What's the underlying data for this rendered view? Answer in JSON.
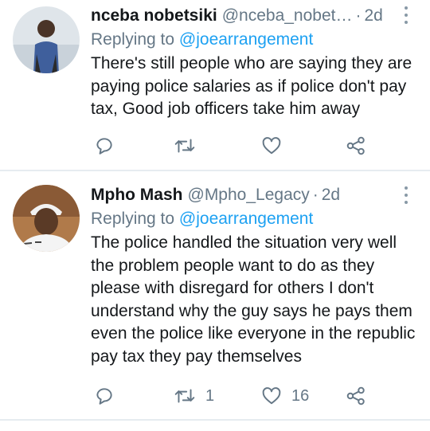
{
  "tweets": [
    {
      "name": "nceba nobetsiki",
      "handle": "@nceba_nobet…",
      "separator": "·",
      "time": "2d",
      "replying_prefix": "Replying to ",
      "replying_handle": "@joearrangement",
      "text": "There's still people who are saying they are paying police salaries as if police don't pay tax, Good job officers take him away",
      "reply_count": "",
      "retweet_count": "",
      "like_count": ""
    },
    {
      "name": "Mpho Mash",
      "handle": "@Mpho_Legacy",
      "separator": "·",
      "time": "2d",
      "replying_prefix": "Replying to ",
      "replying_handle": "@joearrangement",
      "text": "The police handled the situation very well the problem people want to do as they please with disregard for others I don't understand why the guy says he pays them even the police like everyone in the republic pay tax they pay themselves",
      "reply_count": "",
      "retweet_count": "1",
      "like_count": "16"
    }
  ],
  "icons": {
    "reply": "reply-icon",
    "retweet": "retweet-icon",
    "like": "heart-icon",
    "share": "share-icon",
    "more": "more-vertical-icon"
  },
  "colors": {
    "text": "#14171a",
    "secondary": "#657786",
    "link": "#1da1f2",
    "icon": "#657786",
    "divider": "#e6ecf0"
  }
}
